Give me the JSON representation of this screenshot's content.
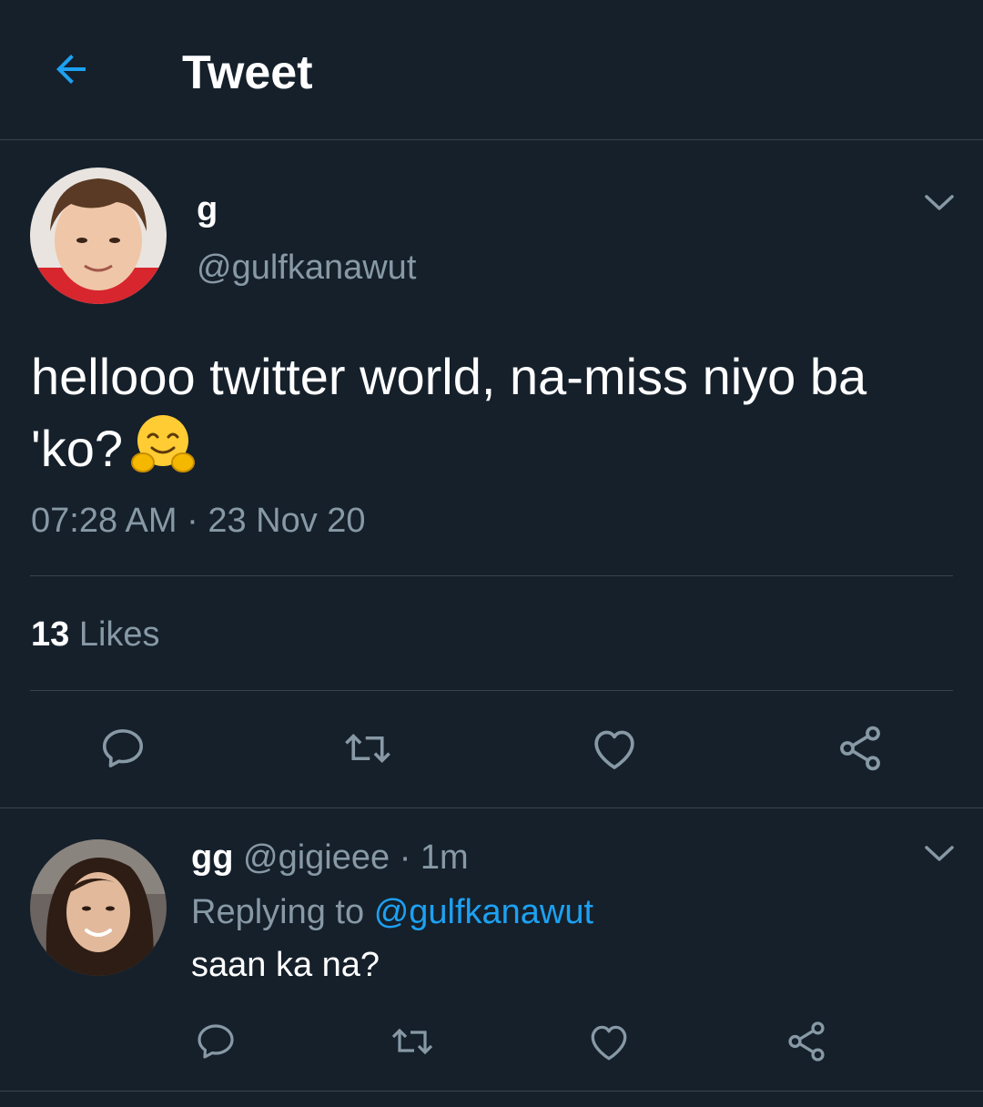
{
  "header": {
    "title": "Tweet",
    "back_icon": "arrow-left-icon"
  },
  "colors": {
    "background": "#15202b",
    "accent": "#1da1f2",
    "secondary_text": "#8899a6",
    "divider": "#38444d"
  },
  "tweet": {
    "author": {
      "display_name": "g",
      "handle": "@gulfkanawut",
      "avatar": "avatar-photo"
    },
    "text": "hellooo twitter world, na-miss niyo ba 'ko?",
    "emoji": "hugging-face-emoji",
    "timestamp": "07:28 AM · 23 Nov 20",
    "likes_count": "13",
    "likes_label": "Likes",
    "actions": [
      "reply-icon",
      "retweet-icon",
      "like-icon",
      "share-icon"
    ]
  },
  "reply": {
    "author": {
      "display_name": "gg",
      "handle": "@gigieee",
      "avatar": "avatar-photo"
    },
    "time_separator": " · ",
    "time_ago": "1m",
    "replying_prefix": "Replying to",
    "replying_to": "@gulfkanawut",
    "text": "saan ka na?",
    "actions": [
      "reply-icon",
      "retweet-icon",
      "like-icon",
      "share-icon"
    ]
  }
}
